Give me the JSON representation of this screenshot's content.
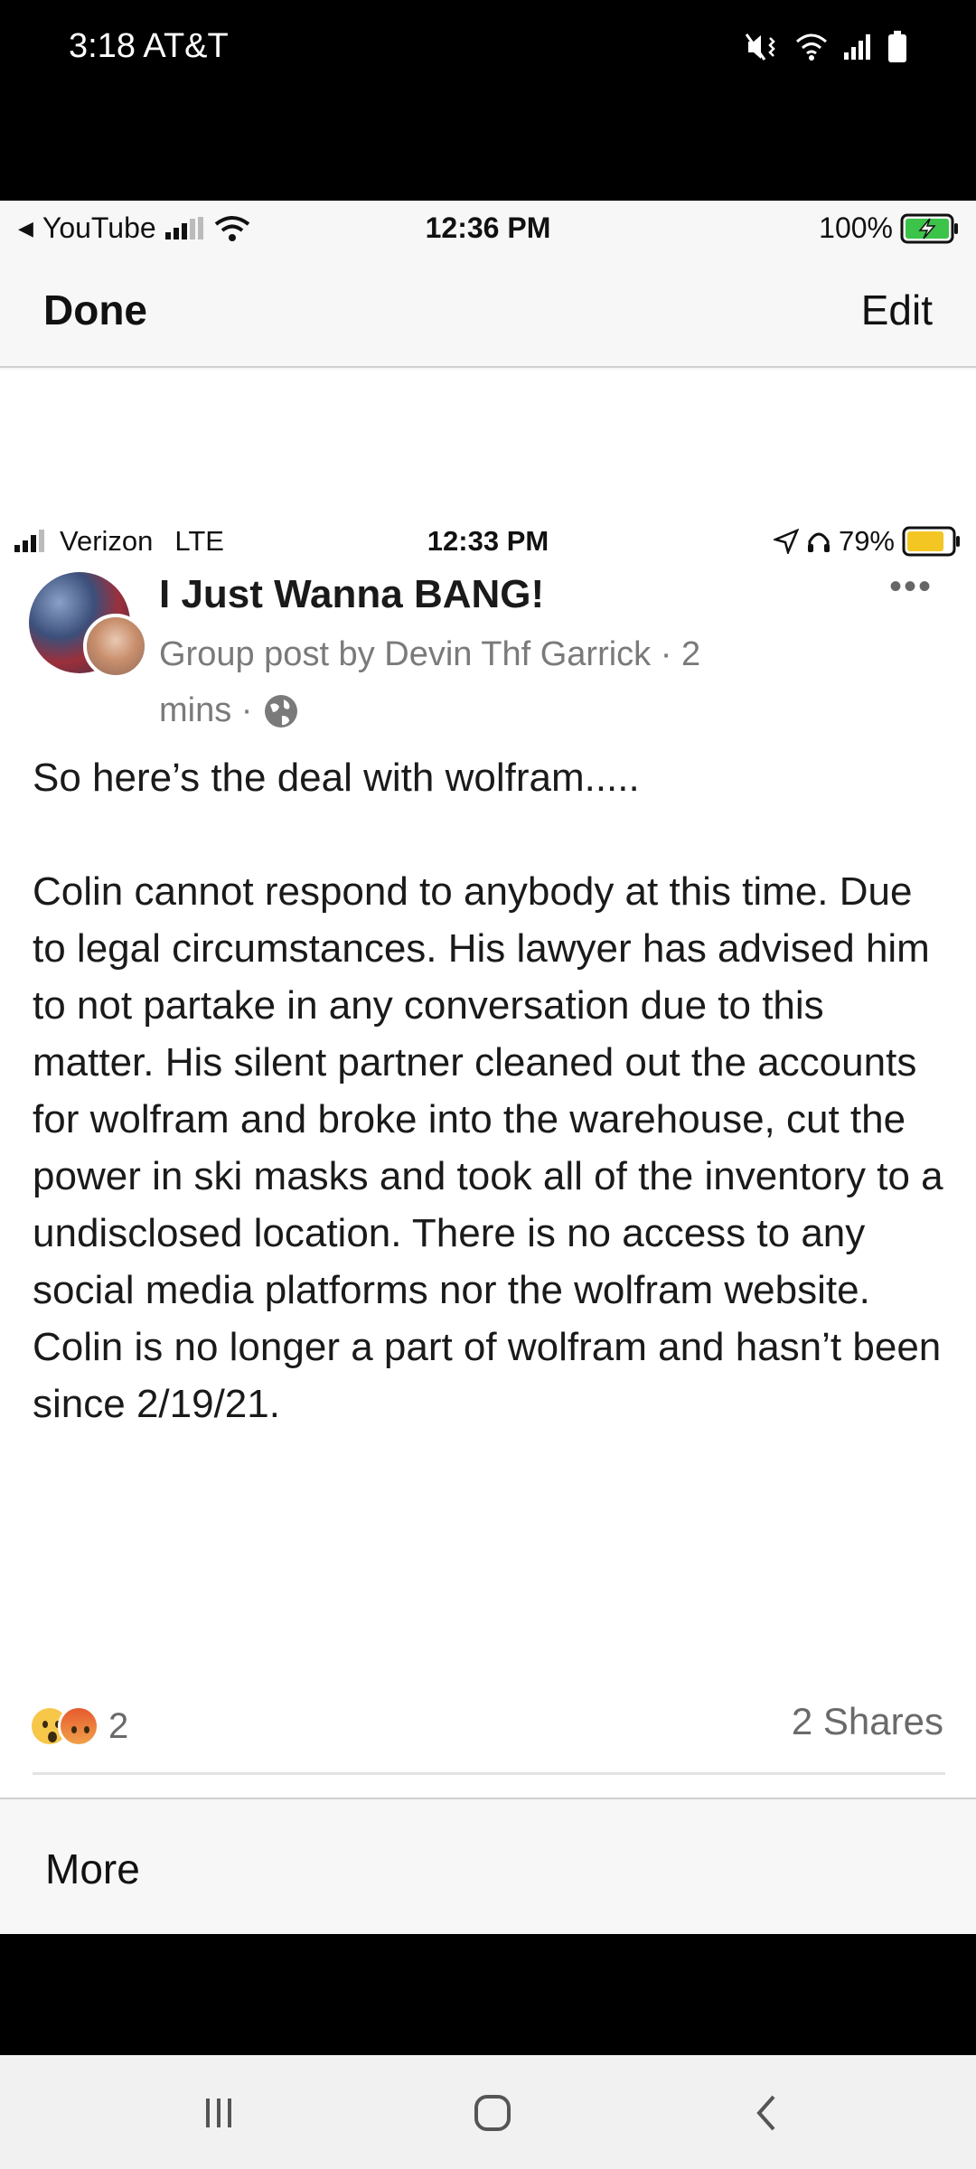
{
  "android_status": {
    "time_carrier": "3:18 AT&T",
    "icons": [
      "mute-vibrate-icon",
      "wifi-icon",
      "signal-icon",
      "battery-icon"
    ]
  },
  "ios_outer": {
    "back_app": "YouTube",
    "time": "12:36 PM",
    "battery": "100%",
    "done_label": "Done",
    "edit_label": "Edit",
    "more_label": "More"
  },
  "ios_inner": {
    "carrier": "Verizon",
    "network": "LTE",
    "time": "12:33 PM",
    "battery": "79%"
  },
  "post": {
    "group_name": "I Just Wanna BANG!",
    "meta_line1": "Group post by Devin Thf Garrick · 2",
    "meta_line2": "mins ·",
    "more_dots": "•••",
    "paragraph1": "So here’s the deal with wolfram.....",
    "paragraph2": "Colin cannot respond to anybody at this time. Due to legal circumstances. His lawyer has advised him to not partake in any conversation due to this matter. His silent partner cleaned out the accounts for wolfram and broke into the warehouse, cut the power in ski masks and took all of the inventory to a undisclosed location. There is no access to any social media platforms nor the wolfram website. Colin is no longer a part of wolfram and hasn’t been since 2/19/21.",
    "reaction_count": "2",
    "shares": "2 Shares"
  },
  "colors": {
    "android_bg": "#000000",
    "viewer_bg": "#f7f7f7",
    "battery_green": "#3cc34a",
    "battery_yellow": "#f3c623"
  }
}
